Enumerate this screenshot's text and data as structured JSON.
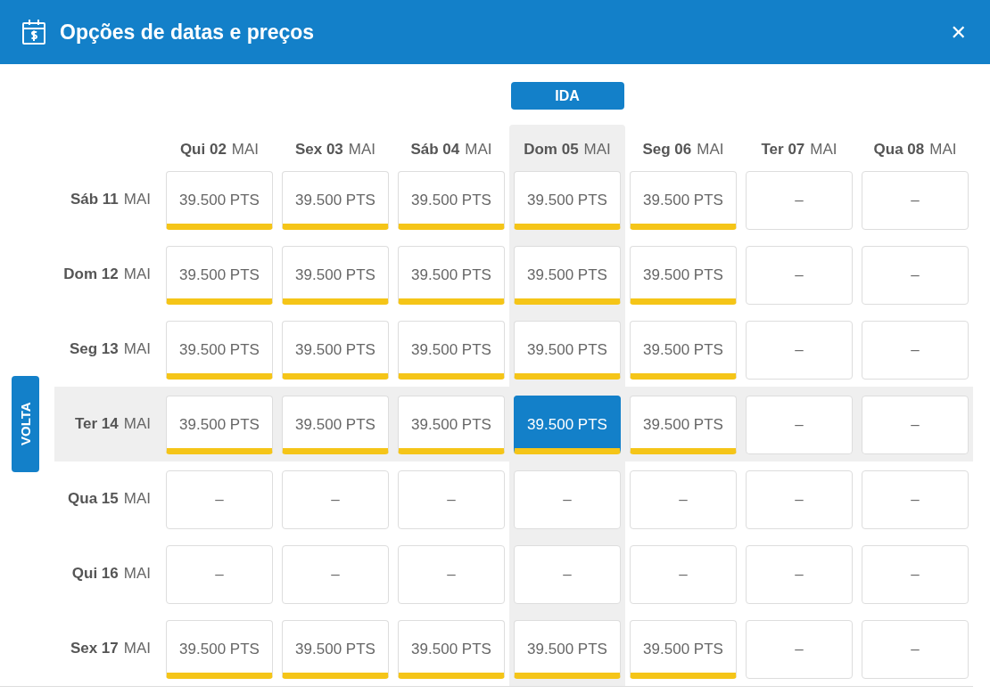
{
  "header": {
    "title": "Opções de datas e preços",
    "close": "✕"
  },
  "outbound_label": "IDA",
  "return_label": "VOLTA",
  "columns": [
    {
      "weekday": "Qui 02",
      "month": "MAI",
      "selected": false
    },
    {
      "weekday": "Sex 03",
      "month": "MAI",
      "selected": false
    },
    {
      "weekday": "Sáb 04",
      "month": "MAI",
      "selected": false
    },
    {
      "weekday": "Dom 05",
      "month": "MAI",
      "selected": true
    },
    {
      "weekday": "Seg 06",
      "month": "MAI",
      "selected": false
    },
    {
      "weekday": "Ter 07",
      "month": "MAI",
      "selected": false
    },
    {
      "weekday": "Qua 08",
      "month": "MAI",
      "selected": false
    }
  ],
  "rows": [
    {
      "weekday": "Sáb 11",
      "month": "MAI",
      "selected": false,
      "cells": [
        {
          "kind": "price",
          "text": "39.500 PTS",
          "selected": false
        },
        {
          "kind": "price",
          "text": "39.500 PTS",
          "selected": false
        },
        {
          "kind": "price",
          "text": "39.500 PTS",
          "selected": false
        },
        {
          "kind": "price",
          "text": "39.500 PTS",
          "selected": false
        },
        {
          "kind": "price",
          "text": "39.500 PTS",
          "selected": false
        },
        {
          "kind": "empty",
          "text": "–",
          "selected": false
        },
        {
          "kind": "empty",
          "text": "–",
          "selected": false
        }
      ]
    },
    {
      "weekday": "Dom 12",
      "month": "MAI",
      "selected": false,
      "cells": [
        {
          "kind": "price",
          "text": "39.500 PTS",
          "selected": false
        },
        {
          "kind": "price",
          "text": "39.500 PTS",
          "selected": false
        },
        {
          "kind": "price",
          "text": "39.500 PTS",
          "selected": false
        },
        {
          "kind": "price",
          "text": "39.500 PTS",
          "selected": false
        },
        {
          "kind": "price",
          "text": "39.500 PTS",
          "selected": false
        },
        {
          "kind": "empty",
          "text": "–",
          "selected": false
        },
        {
          "kind": "empty",
          "text": "–",
          "selected": false
        }
      ]
    },
    {
      "weekday": "Seg 13",
      "month": "MAI",
      "selected": false,
      "cells": [
        {
          "kind": "price",
          "text": "39.500 PTS",
          "selected": false
        },
        {
          "kind": "price",
          "text": "39.500 PTS",
          "selected": false
        },
        {
          "kind": "price",
          "text": "39.500 PTS",
          "selected": false
        },
        {
          "kind": "price",
          "text": "39.500 PTS",
          "selected": false
        },
        {
          "kind": "price",
          "text": "39.500 PTS",
          "selected": false
        },
        {
          "kind": "empty",
          "text": "–",
          "selected": false
        },
        {
          "kind": "empty",
          "text": "–",
          "selected": false
        }
      ]
    },
    {
      "weekday": "Ter 14",
      "month": "MAI",
      "selected": true,
      "cells": [
        {
          "kind": "price",
          "text": "39.500 PTS",
          "selected": false
        },
        {
          "kind": "price",
          "text": "39.500 PTS",
          "selected": false
        },
        {
          "kind": "price",
          "text": "39.500 PTS",
          "selected": false
        },
        {
          "kind": "price",
          "text": "39.500 PTS",
          "selected": true
        },
        {
          "kind": "price",
          "text": "39.500 PTS",
          "selected": false
        },
        {
          "kind": "empty",
          "text": "–",
          "selected": false
        },
        {
          "kind": "empty",
          "text": "–",
          "selected": false
        }
      ]
    },
    {
      "weekday": "Qua 15",
      "month": "MAI",
      "selected": false,
      "cells": [
        {
          "kind": "empty",
          "text": "–",
          "selected": false
        },
        {
          "kind": "empty",
          "text": "–",
          "selected": false
        },
        {
          "kind": "empty",
          "text": "–",
          "selected": false
        },
        {
          "kind": "empty",
          "text": "–",
          "selected": false
        },
        {
          "kind": "empty",
          "text": "–",
          "selected": false
        },
        {
          "kind": "empty",
          "text": "–",
          "selected": false
        },
        {
          "kind": "empty",
          "text": "–",
          "selected": false
        }
      ]
    },
    {
      "weekday": "Qui 16",
      "month": "MAI",
      "selected": false,
      "cells": [
        {
          "kind": "empty",
          "text": "–",
          "selected": false
        },
        {
          "kind": "empty",
          "text": "–",
          "selected": false
        },
        {
          "kind": "empty",
          "text": "–",
          "selected": false
        },
        {
          "kind": "empty",
          "text": "–",
          "selected": false
        },
        {
          "kind": "empty",
          "text": "–",
          "selected": false
        },
        {
          "kind": "empty",
          "text": "–",
          "selected": false
        },
        {
          "kind": "empty",
          "text": "–",
          "selected": false
        }
      ]
    },
    {
      "weekday": "Sex 17",
      "month": "MAI",
      "selected": false,
      "cells": [
        {
          "kind": "price",
          "text": "39.500 PTS",
          "selected": false
        },
        {
          "kind": "price",
          "text": "39.500 PTS",
          "selected": false
        },
        {
          "kind": "price",
          "text": "39.500 PTS",
          "selected": false
        },
        {
          "kind": "price",
          "text": "39.500 PTS",
          "selected": false
        },
        {
          "kind": "price",
          "text": "39.500 PTS",
          "selected": false
        },
        {
          "kind": "empty",
          "text": "–",
          "selected": false
        },
        {
          "kind": "empty",
          "text": "–",
          "selected": false
        }
      ]
    }
  ]
}
